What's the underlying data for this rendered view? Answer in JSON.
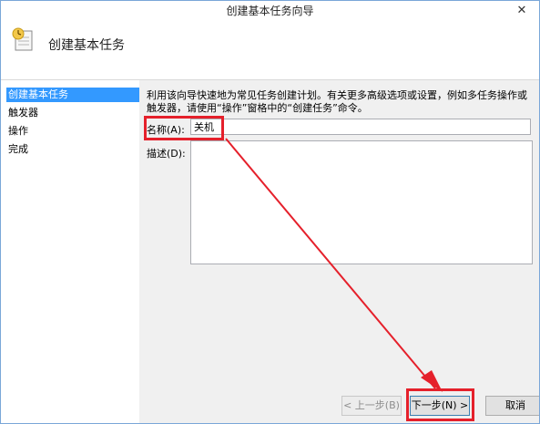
{
  "window": {
    "title": "创建基本任务向导",
    "close_symbol": "✕"
  },
  "header": {
    "title": "创建基本任务",
    "icon": "task-clock-icon"
  },
  "nav": {
    "items": [
      {
        "label": "创建基本任务",
        "active": true
      },
      {
        "label": "触发器",
        "active": false
      },
      {
        "label": "操作",
        "active": false
      },
      {
        "label": "完成",
        "active": false
      }
    ]
  },
  "form": {
    "intro": "利用该向导快速地为常见任务创建计划。有关更多高级选项或设置，例如多任务操作或触发器，请使用“操作”窗格中的“创建任务”命令。",
    "name_label": "名称(A):",
    "name_value": "关机",
    "description_label": "描述(D):",
    "description_value": ""
  },
  "buttons": {
    "back": "< 上一步(B)",
    "next": "下一步(N) >",
    "cancel": "取消"
  },
  "annotation": {
    "color": "#e5202b"
  }
}
